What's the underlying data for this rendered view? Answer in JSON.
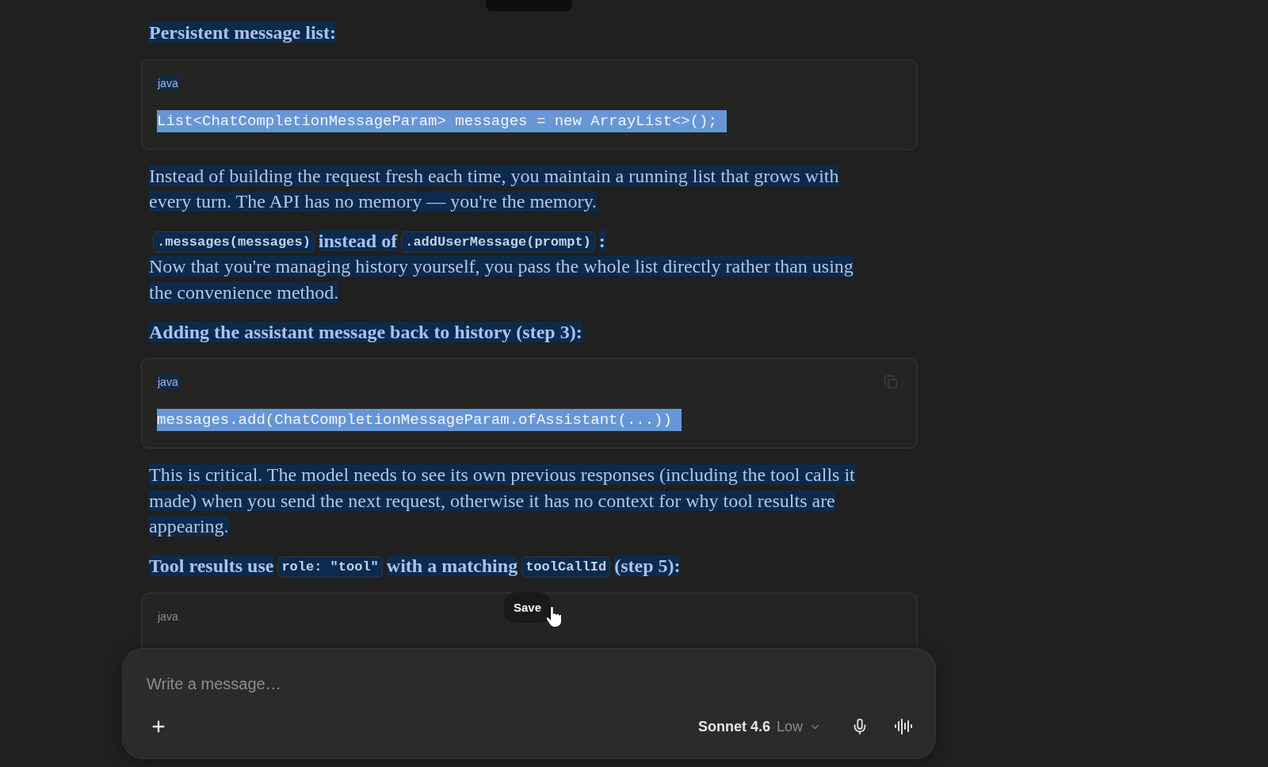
{
  "message": {
    "blocks": [
      {
        "kind": "heading",
        "selected": true,
        "parts": [
          {
            "kind": "text",
            "text": "Persistent message list:"
          }
        ]
      },
      {
        "kind": "code",
        "selected": true,
        "copy_shown": false,
        "language": "java",
        "lines": [
          "List<ChatCompletionMessageParam> messages = new ArrayList<>();"
        ]
      },
      {
        "kind": "paragraph",
        "selected": true,
        "text": "Instead of building the request fresh each time, you maintain a running list that grows with every turn. The API has no memory — you're the memory."
      },
      {
        "kind": "paragraph",
        "selected": true,
        "lead": [
          {
            "kind": "code",
            "text": ".messages(messages)"
          },
          {
            "kind": "text",
            "text": "instead of"
          },
          {
            "kind": "code",
            "text": ".addUserMessage(prompt)"
          },
          {
            "kind": "text",
            "text": ":"
          }
        ],
        "text": "Now that you're managing history yourself, you pass the whole list directly rather than using the convenience method."
      },
      {
        "kind": "heading",
        "selected": true,
        "parts": [
          {
            "kind": "text",
            "text": "Adding the assistant message back to history (step 3):"
          }
        ]
      },
      {
        "kind": "code",
        "selected": true,
        "copy_shown": true,
        "language": "java",
        "lines": [
          "messages.add(ChatCompletionMessageParam.ofAssistant(...))"
        ]
      },
      {
        "kind": "paragraph",
        "selected": true,
        "text": "This is critical. The model needs to see its own previous responses (including the tool calls it made) when you send the next request, otherwise it has no context for why tool results are appearing."
      },
      {
        "kind": "heading",
        "selected": true,
        "parts": [
          {
            "kind": "text",
            "text": "Tool results use"
          },
          {
            "kind": "code",
            "text": "role: \"tool\""
          },
          {
            "kind": "text",
            "text": "with a matching"
          },
          {
            "kind": "code",
            "text": "toolCallId"
          },
          {
            "kind": "text",
            "text": "(step 5):"
          }
        ]
      },
      {
        "kind": "code",
        "selected": false,
        "copy_shown": false,
        "language": "java"
      }
    ]
  },
  "tooltip": {
    "text": "Save"
  },
  "composer": {
    "placeholder": "Write a message…",
    "model": "Sonnet 4.6",
    "effort": "Low"
  }
}
